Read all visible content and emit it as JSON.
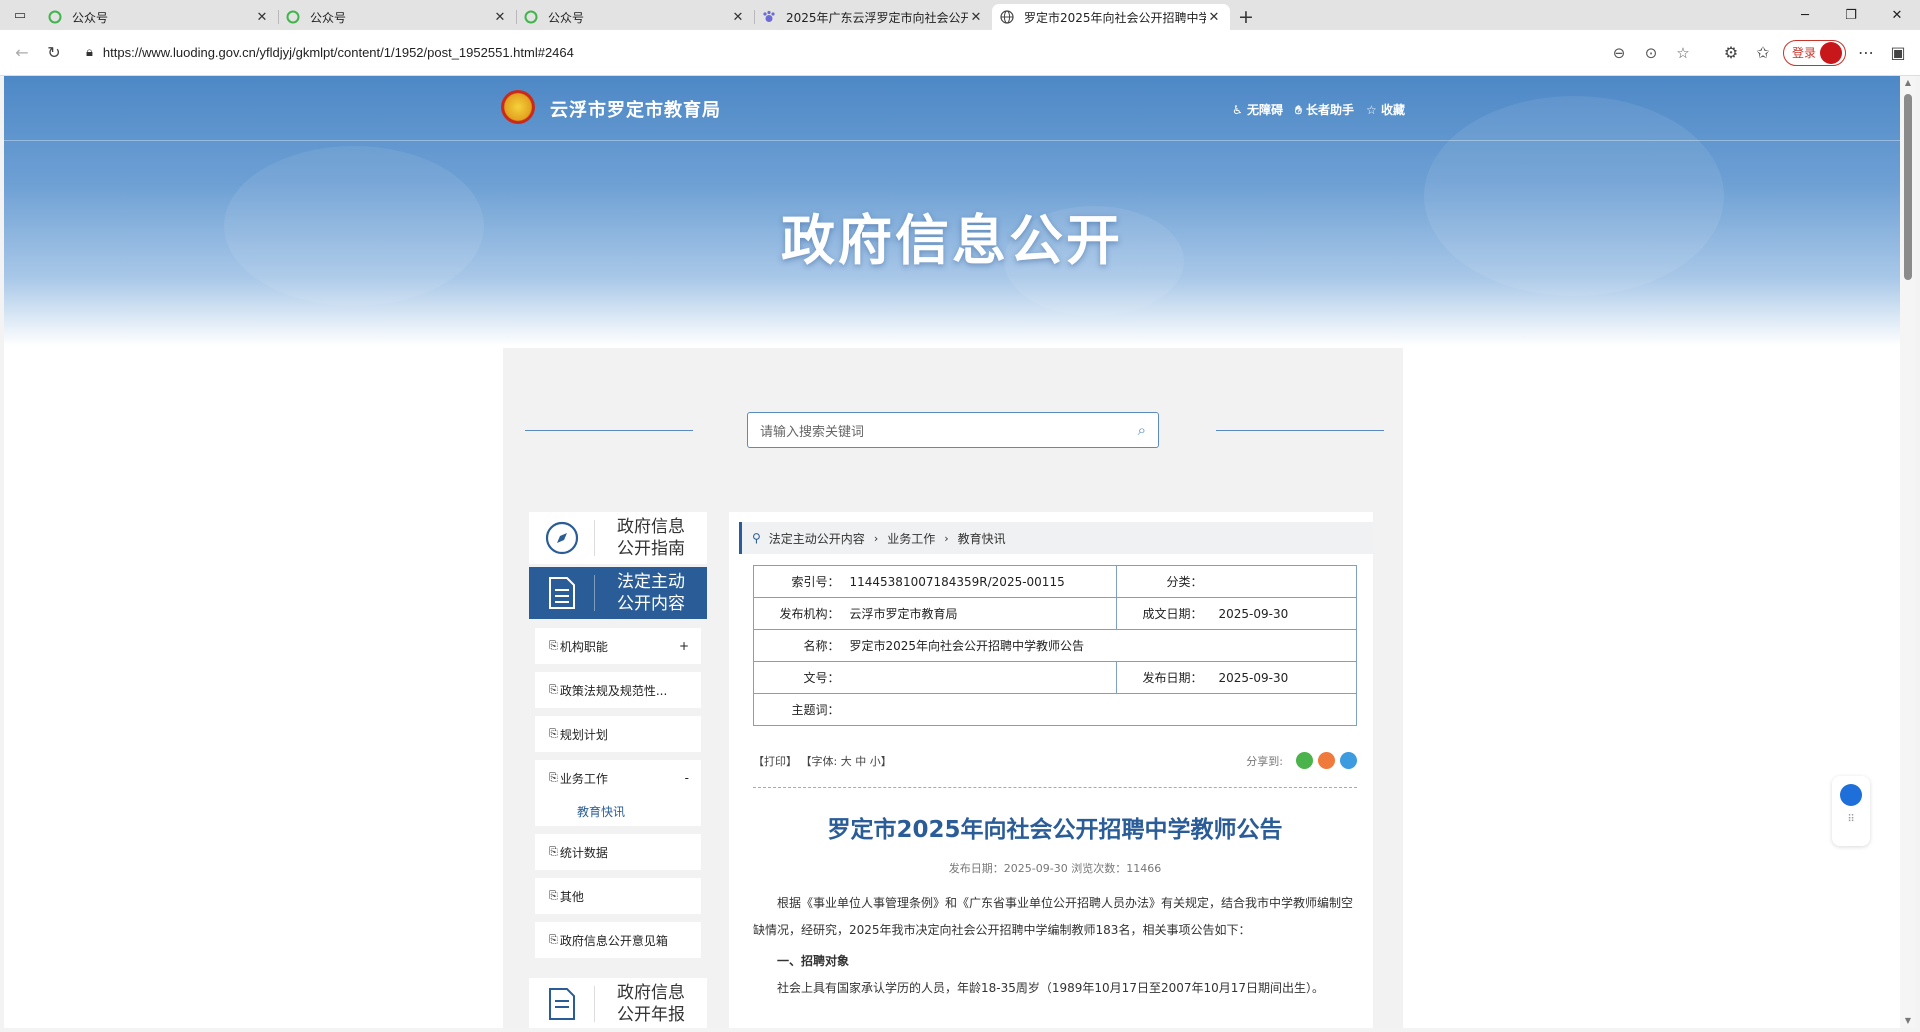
{
  "browser": {
    "tabs": [
      {
        "title": "公众号",
        "icon": "wechat-green-icon"
      },
      {
        "title": "公众号",
        "icon": "wechat-green-icon"
      },
      {
        "title": "公众号",
        "icon": "wechat-green-icon"
      },
      {
        "title": "2025年广东云浮罗定市向社会公开",
        "icon": "paw-icon"
      },
      {
        "title": "罗定市2025年向社会公开招聘中学",
        "icon": "globe-icon"
      }
    ],
    "url": "https://www.luoding.gov.cn/yfldjyj/gkmlpt/content/1/1952/post_1952551.html#2464",
    "login_label": "登录"
  },
  "header": {
    "site_name": "云浮市罗定市教育局",
    "links": [
      "无障碍",
      "长者助手",
      "收藏"
    ],
    "banner_title": "政府信息公开"
  },
  "search": {
    "placeholder": "请输入搜索关键词"
  },
  "sidebar": {
    "guide_label": "政府信息公开指南",
    "content_label": "法定主动公开内容",
    "items": [
      {
        "label": "机构职能",
        "toggle": "+"
      },
      {
        "label": "政策法规及规范性...",
        "toggle": ""
      },
      {
        "label": "规划计划",
        "toggle": ""
      },
      {
        "label": "业务工作",
        "toggle": "-",
        "sub": "教育快讯"
      },
      {
        "label": "统计数据",
        "toggle": ""
      },
      {
        "label": "其他",
        "toggle": ""
      },
      {
        "label": "政府信息公开意见箱",
        "toggle": ""
      }
    ],
    "annual_label": "政府信息公开年报"
  },
  "breadcrumb": [
    "法定主动公开内容",
    "业务工作",
    "教育快讯"
  ],
  "meta": {
    "index_k": "索引号：",
    "index_v": "11445381007184359R/2025-00115",
    "category_k": "分类：",
    "category_v": "",
    "publisher_k": "发布机构：",
    "publisher_v": "云浮市罗定市教育局",
    "created_k": "成文日期：",
    "created_v": "2025-09-30",
    "name_k": "名称：",
    "name_v": "罗定市2025年向社会公开招聘中学教师公告",
    "docno_k": "文号：",
    "docno_v": "",
    "pubdate_k": "发布日期：",
    "pubdate_v": "2025-09-30",
    "subject_k": "主题词：",
    "subject_v": ""
  },
  "tools": {
    "print": "【打印】",
    "font_label": "【字体:",
    "font_large": "大",
    "font_medium": "中",
    "font_small": "小】",
    "share_label": "分享到:"
  },
  "article": {
    "title": "罗定市2025年向社会公开招聘中学教师公告",
    "meta": "发布日期：2025-09-30  浏览次数：11466",
    "p1": "根据《事业单位人事管理条例》和《广东省事业单位公开招聘人员办法》有关规定，结合我市中学教师编制空缺情况，经研究，2025年我市决定向社会公开招聘中学编制教师183名，相关事项公告如下：",
    "h1": "一、招聘对象",
    "p2": "社会上具有国家承认学历的人员，年龄18-35周岁（1989年10月17日至2007年10月17日期间出生）。"
  }
}
